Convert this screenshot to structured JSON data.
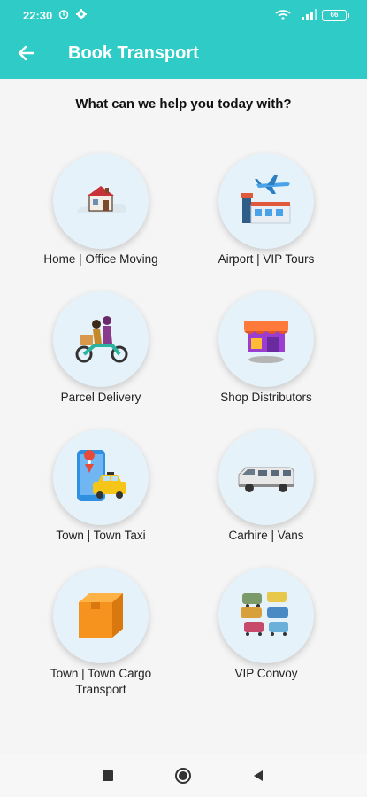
{
  "status_bar": {
    "time": "22:30",
    "battery": "66"
  },
  "header": {
    "title": "Book Transport",
    "background": "#2fcbc6"
  },
  "prompt": "What can we help you today with?",
  "services": [
    {
      "label": "Home | Office Moving",
      "icon": "house-moving-icon"
    },
    {
      "label": "Airport | VIP Tours",
      "icon": "airport-icon"
    },
    {
      "label": "Parcel Delivery",
      "icon": "motorbike-delivery-icon"
    },
    {
      "label": "Shop Distributors",
      "icon": "shop-icon"
    },
    {
      "label": "Town | Town Taxi",
      "icon": "taxi-icon"
    },
    {
      "label": "Carhire | Vans",
      "icon": "van-icon"
    },
    {
      "label": "Town | Town Cargo Transport",
      "icon": "cargo-box-icon"
    },
    {
      "label": "VIP Convoy",
      "icon": "convoy-icon"
    }
  ]
}
